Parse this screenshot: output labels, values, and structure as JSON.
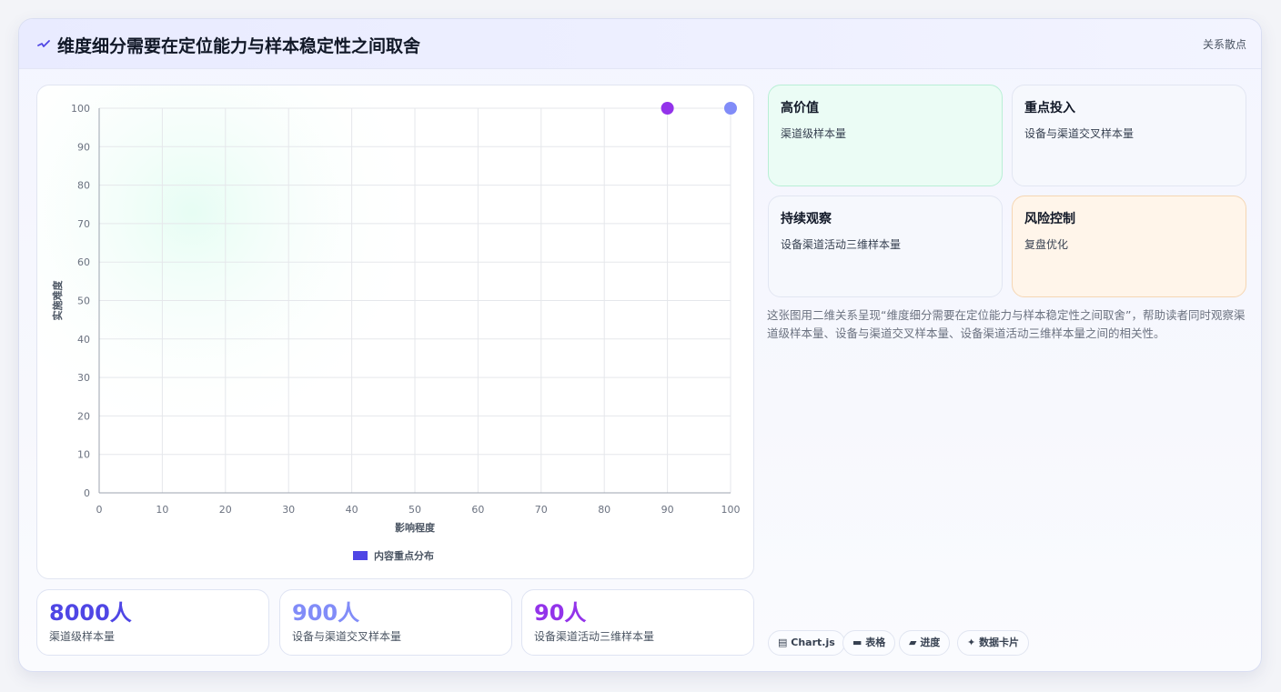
{
  "header": {
    "title": "维度细分需要在定位能力与样本稳定性之间取舍",
    "tag": "关系散点"
  },
  "chart_data": {
    "type": "scatter",
    "xlabel": "影响程度",
    "ylabel": "实施难度",
    "xlim": [
      0,
      100
    ],
    "ylim": [
      0,
      100
    ],
    "xticks": [
      "0",
      "10",
      "20",
      "30",
      "40",
      "50",
      "60",
      "70",
      "80",
      "90",
      "100"
    ],
    "yticks": [
      "0",
      "10",
      "20",
      "30",
      "40",
      "50",
      "60",
      "70",
      "80",
      "90",
      "100"
    ],
    "grid": true,
    "legend": "bottom",
    "series": [
      {
        "name": "内容重点分布",
        "color": "#4f46e5",
        "points": [
          {
            "x": 90,
            "y": 100,
            "color": "#9333ea"
          },
          {
            "x": 100,
            "y": 100,
            "color": "#818cf8"
          }
        ]
      }
    ]
  },
  "stats": [
    {
      "value": "8000人",
      "label": "渠道级样本量",
      "color": "#4f46e5"
    },
    {
      "value": "900人",
      "label": "设备与渠道交叉样本量",
      "color": "#818cf8"
    },
    {
      "value": "90人",
      "label": "设备渠道活动三维样本量",
      "color": "#9333ea"
    }
  ],
  "quadrants": [
    {
      "title": "高价值",
      "subtitle": "渠道级样本量",
      "bg": "#ebfcf5",
      "border": "#b9efd6"
    },
    {
      "title": "重点投入",
      "subtitle": "设备与渠道交叉样本量",
      "bg": "#f6f8fd",
      "border": "#e2e6f2"
    },
    {
      "title": "持续观察",
      "subtitle": "设备渠道活动三维样本量",
      "bg": "#f6f8fd",
      "border": "#e2e6f2"
    },
    {
      "title": "风险控制",
      "subtitle": "复盘优化",
      "bg": "#fff5ea",
      "border": "#f5d6b3"
    }
  ],
  "description": "这张图用二维关系呈现“维度细分需要在定位能力与样本稳定性之间取舍”，帮助读者同时观察渠道级样本量、设备与渠道交叉样本量、设备渠道活动三维样本量之间的相关性。",
  "chips": [
    {
      "icon": "▤",
      "label": "Chart.js",
      "icon_name": "chart-icon"
    },
    {
      "icon": "▬",
      "label": "表格",
      "icon_name": "table-icon"
    },
    {
      "icon": "▰",
      "label": "进度",
      "icon_name": "progress-icon"
    },
    {
      "icon": "✦",
      "label": "数据卡片",
      "icon_name": "sparkle-icon"
    }
  ]
}
